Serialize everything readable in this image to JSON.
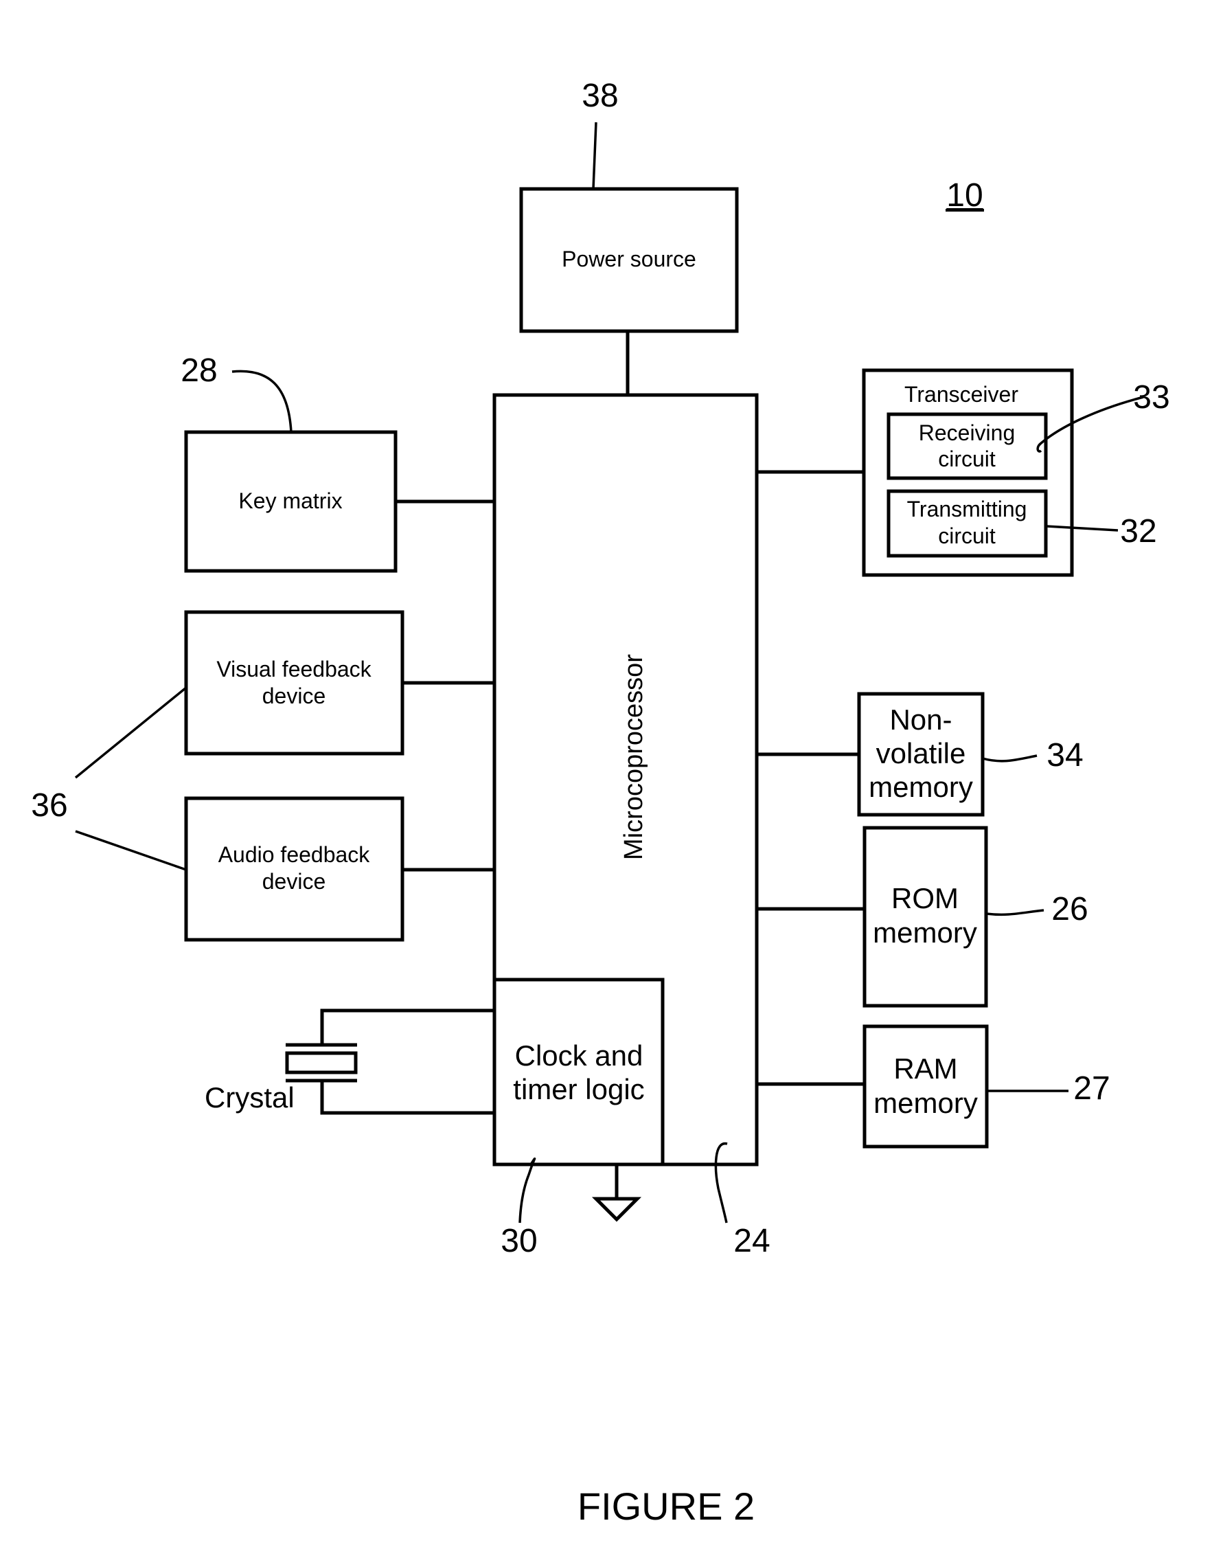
{
  "figure": {
    "caption": "FIGURE 2",
    "device_ref": "10"
  },
  "blocks": {
    "power_source": {
      "label": "Power source",
      "ref": "38"
    },
    "microprocessor": {
      "label": "Microcoprocessor",
      "ref": "24"
    },
    "key_matrix": {
      "label": "Key matrix",
      "ref": "28"
    },
    "visual_feedback": {
      "label_line1": "Visual feedback",
      "label_line2": "device"
    },
    "audio_feedback": {
      "label_line1": "Audio feedback",
      "label_line2": "device"
    },
    "feedback_ref": "36",
    "clock_timer": {
      "label_line1": "Clock and",
      "label_line2": "timer logic",
      "ref": "30"
    },
    "crystal": {
      "label": "Crystal"
    },
    "transceiver": {
      "label": "Transceiver"
    },
    "receiving": {
      "label_line1": "Receiving",
      "label_line2": "circuit",
      "ref": "33"
    },
    "transmitting": {
      "label_line1": "Transmitting",
      "label_line2": "circuit",
      "ref": "32"
    },
    "nonvolatile": {
      "label_line1": "Non-",
      "label_line2": "volatile",
      "label_line3": "memory",
      "ref": "34"
    },
    "rom": {
      "label_line1": "ROM",
      "label_line2": "memory",
      "ref": "26"
    },
    "ram": {
      "label_line1": "RAM",
      "label_line2": "memory",
      "ref": "27"
    }
  }
}
